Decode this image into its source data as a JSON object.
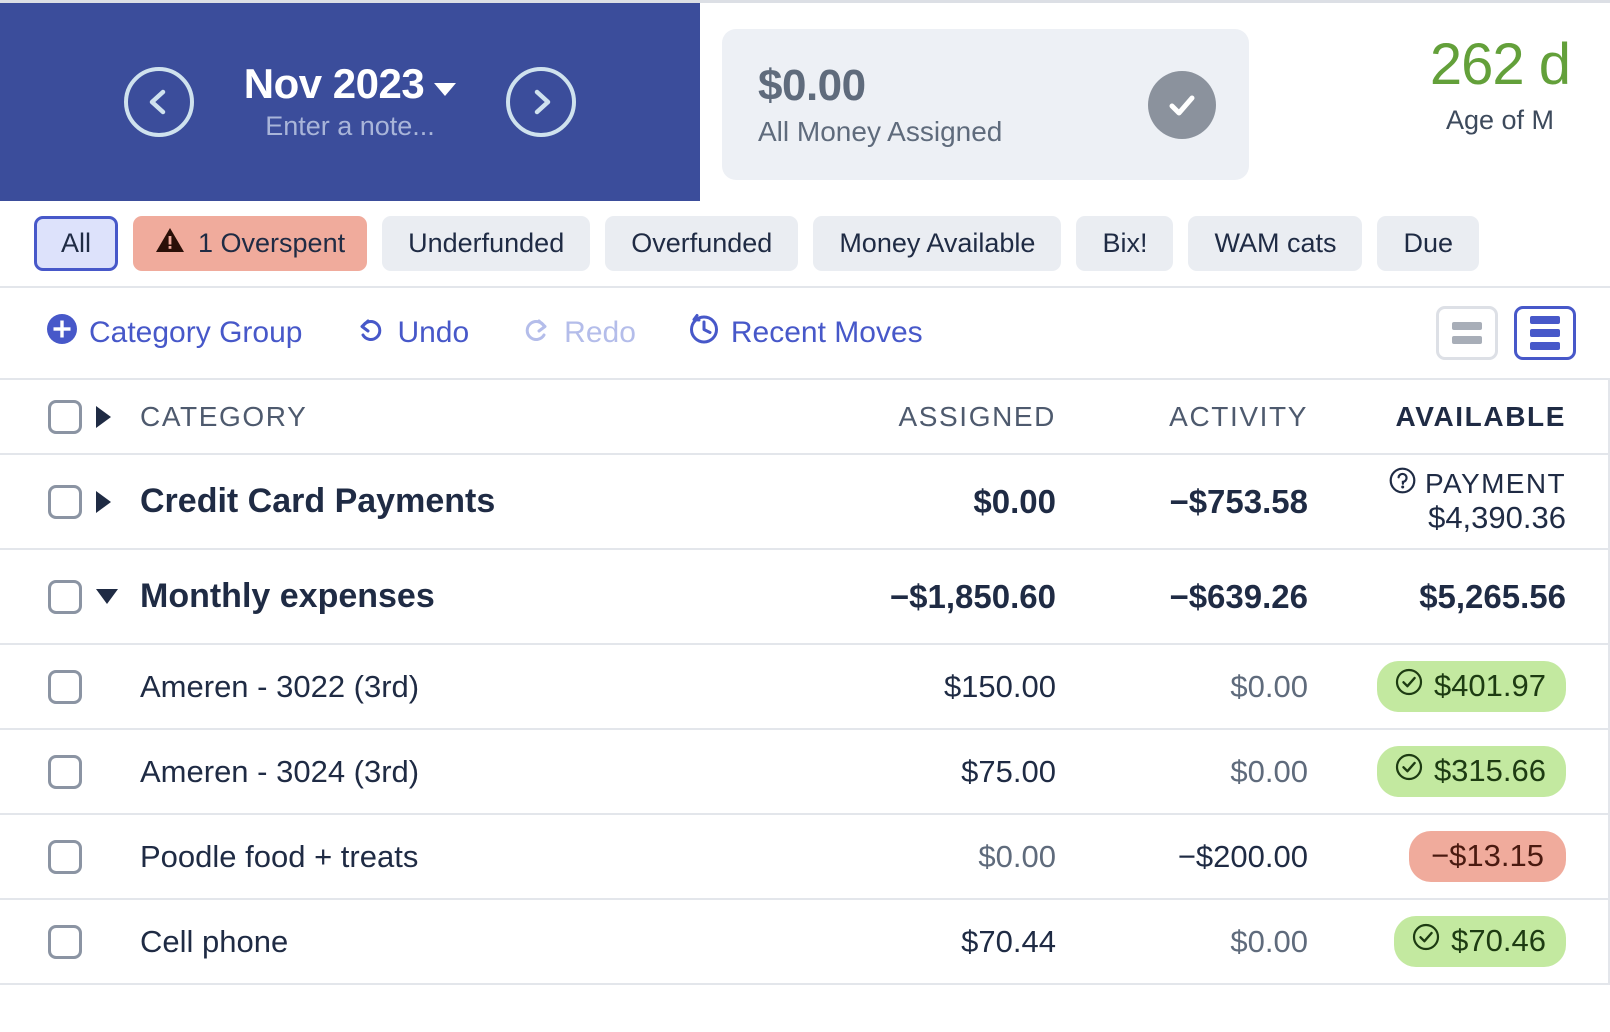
{
  "header": {
    "month": "Nov 2023",
    "note_placeholder": "Enter a note...",
    "prev_icon": "chevron-left-icon",
    "next_icon": "chevron-right-icon",
    "assigned": {
      "amount": "$0.00",
      "label": "All Money Assigned",
      "status_icon": "check-circle-icon"
    },
    "age_of_money": {
      "value": "262 d",
      "label": "Age of M",
      "color": "#63a03a"
    }
  },
  "filters": [
    {
      "label": "All",
      "state": "active"
    },
    {
      "label": "1 Overspent",
      "state": "overspent",
      "icon": "warning-triangle-icon"
    },
    {
      "label": "Underfunded",
      "state": "default"
    },
    {
      "label": "Overfunded",
      "state": "default"
    },
    {
      "label": "Money Available",
      "state": "default"
    },
    {
      "label": "Bix!",
      "state": "default"
    },
    {
      "label": "WAM cats",
      "state": "default"
    },
    {
      "label": "Due",
      "state": "default"
    }
  ],
  "toolbar": {
    "category_group": "Category Group",
    "undo": "Undo",
    "redo": "Redo",
    "recent_moves": "Recent Moves",
    "view_compact": "compact-view-toggle",
    "view_expanded": "expanded-view-toggle"
  },
  "table": {
    "columns": {
      "category": "CATEGORY",
      "assigned": "ASSIGNED",
      "activity": "ACTIVITY",
      "available": "AVAILABLE"
    },
    "rows": [
      {
        "type": "group",
        "name": "Credit Card Payments",
        "expanded": false,
        "assigned": "$0.00",
        "activity": "−$753.58",
        "available_kind": "payment",
        "payment_label": "PAYMENT",
        "payment_icon": "question-circle-icon",
        "available": "$4,390.36"
      },
      {
        "type": "group",
        "name": "Monthly expenses",
        "expanded": true,
        "assigned": "−$1,850.60",
        "activity": "−$639.26",
        "available_kind": "plain",
        "available": "$5,265.56"
      },
      {
        "type": "category",
        "name": "Ameren - 3022 (3rd)",
        "assigned": "$150.00",
        "activity": "$0.00",
        "available_kind": "green",
        "available": "$401.97",
        "badge_icon": "check-circle-icon"
      },
      {
        "type": "category",
        "name": "Ameren - 3024 (3rd)",
        "assigned": "$75.00",
        "activity": "$0.00",
        "available_kind": "green",
        "available": "$315.66",
        "badge_icon": "check-circle-icon"
      },
      {
        "type": "category",
        "name": "Poodle food + treats",
        "assigned": "$0.00",
        "activity": "−$200.00",
        "available_kind": "red",
        "available": "−$13.15"
      },
      {
        "type": "category",
        "name": "Cell phone",
        "assigned": "$70.44",
        "activity": "$0.00",
        "available_kind": "green",
        "available": "$70.46",
        "badge_icon": "check-circle-icon"
      }
    ]
  },
  "colors": {
    "brand_blue": "#3b4d9b",
    "accent_blue": "#4758c9",
    "green_badge": "#c3e9a0",
    "red_badge": "#f0ab9c",
    "age_green": "#63a03a"
  }
}
